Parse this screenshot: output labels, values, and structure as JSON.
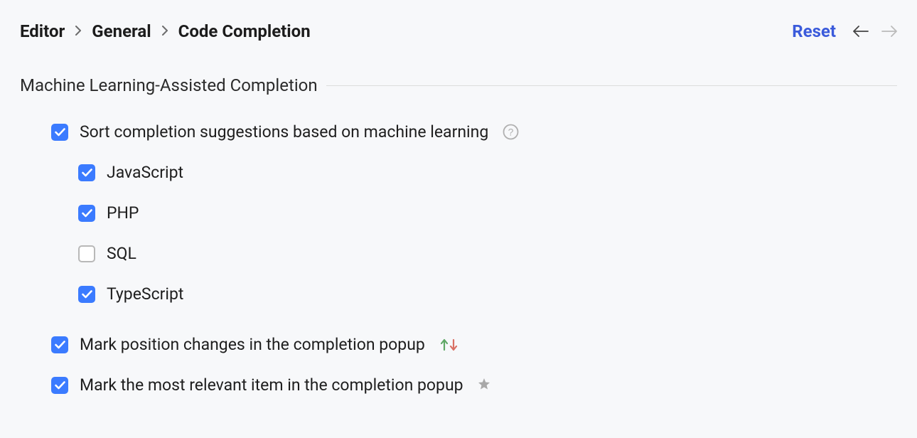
{
  "breadcrumb": {
    "item1": "Editor",
    "item2": "General",
    "item3": "Code Completion"
  },
  "header": {
    "reset_label": "Reset"
  },
  "section": {
    "title": "Machine Learning-Assisted Completion"
  },
  "options": {
    "sort_suggestions": {
      "label": "Sort completion suggestions based on machine learning",
      "checked": true
    },
    "languages": [
      {
        "label": "JavaScript",
        "checked": true
      },
      {
        "label": "PHP",
        "checked": true
      },
      {
        "label": "SQL",
        "checked": false
      },
      {
        "label": "TypeScript",
        "checked": true
      }
    ],
    "mark_position": {
      "label": "Mark position changes in the completion popup",
      "checked": true
    },
    "mark_relevant": {
      "label": "Mark the most relevant item in the completion popup",
      "checked": true
    }
  }
}
